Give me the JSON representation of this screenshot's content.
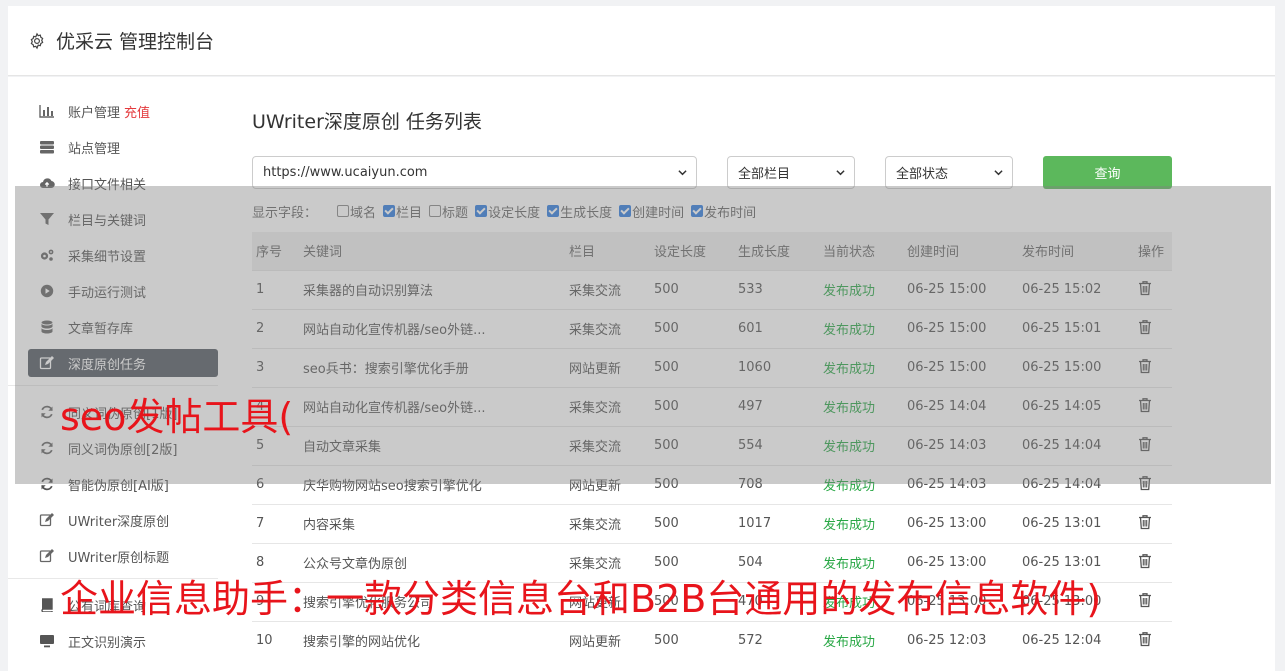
{
  "header": {
    "title": "优采云 管理控制台",
    "icon": "gear-icon"
  },
  "sidebar": {
    "items": [
      {
        "label": "账户管理",
        "badge": "充值",
        "icon": "bar-chart-icon"
      },
      {
        "label": "站点管理",
        "icon": "server-icon"
      },
      {
        "label": "接口文件相关",
        "icon": "cloud-upload-icon"
      },
      {
        "label": "栏目与关键词",
        "icon": "filter-icon"
      },
      {
        "label": "采集细节设置",
        "icon": "gears-icon"
      },
      {
        "label": "手动运行测试",
        "icon": "play-circle-icon"
      },
      {
        "label": "文章暂存库",
        "icon": "database-icon"
      },
      {
        "label": "深度原创任务",
        "icon": "edit-icon",
        "active": true
      },
      {
        "label": "同义词伪原创[1版]",
        "icon": "refresh-icon"
      },
      {
        "label": "同义词伪原创[2版]",
        "icon": "refresh-icon"
      },
      {
        "label": "智能伪原创[AI版]",
        "icon": "refresh-icon"
      },
      {
        "label": "UWriter深度原创",
        "icon": "edit-icon"
      },
      {
        "label": "UWriter原创标题",
        "icon": "edit-icon"
      },
      {
        "label": "公有词库查询",
        "icon": "book-icon"
      },
      {
        "label": "正文识别演示",
        "icon": "monitor-icon"
      }
    ]
  },
  "main": {
    "title": "UWriter深度原创 任务列表",
    "filters": {
      "site": "https://www.ucaiyun.com",
      "column": "全部栏目",
      "status": "全部状态",
      "query_label": "查询"
    },
    "fields_label": "显示字段：",
    "fields": [
      {
        "label": "域名",
        "checked": false
      },
      {
        "label": "栏目",
        "checked": true
      },
      {
        "label": "标题",
        "checked": false
      },
      {
        "label": "设定长度",
        "checked": true
      },
      {
        "label": "生成长度",
        "checked": true
      },
      {
        "label": "创建时间",
        "checked": true
      },
      {
        "label": "发布时间",
        "checked": true
      }
    ],
    "table": {
      "headers": [
        "序号",
        "关键词",
        "栏目",
        "设定长度",
        "生成长度",
        "当前状态",
        "创建时间",
        "发布时间",
        "操作"
      ],
      "rows": [
        [
          "1",
          "采集器的自动识别算法",
          "采集交流",
          "500",
          "533",
          "发布成功",
          "06-25 15:00",
          "06-25 15:02"
        ],
        [
          "2",
          "网站自动化宣传机器/seo外链...",
          "采集交流",
          "500",
          "601",
          "发布成功",
          "06-25 15:00",
          "06-25 15:01"
        ],
        [
          "3",
          "seo兵书：搜索引擎优化手册",
          "网站更新",
          "500",
          "1060",
          "发布成功",
          "06-25 15:00",
          "06-25 15:00"
        ],
        [
          "4",
          "网站自动化宣传机器/seo外链...",
          "采集交流",
          "500",
          "497",
          "发布成功",
          "06-25 14:04",
          "06-25 14:05"
        ],
        [
          "5",
          "自动文章采集",
          "采集交流",
          "500",
          "554",
          "发布成功",
          "06-25 14:03",
          "06-25 14:04"
        ],
        [
          "6",
          "庆华购物网站seo搜索引擎优化",
          "网站更新",
          "500",
          "708",
          "发布成功",
          "06-25 14:03",
          "06-25 14:04"
        ],
        [
          "7",
          "内容采集",
          "采集交流",
          "500",
          "1017",
          "发布成功",
          "06-25 13:00",
          "06-25 13:01"
        ],
        [
          "8",
          "公众号文章伪原创",
          "采集交流",
          "500",
          "504",
          "发布成功",
          "06-25 13:00",
          "06-25 13:01"
        ],
        [
          "9",
          "搜索引擎优化服务公司",
          "网站更新",
          "500",
          "470",
          "发布成功",
          "06-25 13:00",
          "06-25 13:00"
        ],
        [
          "10",
          "搜索引擎的网站优化",
          "网站更新",
          "500",
          "572",
          "发布成功",
          "06-25 12:03",
          "06-25 12:04"
        ]
      ]
    }
  },
  "watermark": {
    "line1": "seo发帖工具(",
    "line2": "企业信息助手：一款分类信息台和B2B台通用的发布信息软件)"
  }
}
